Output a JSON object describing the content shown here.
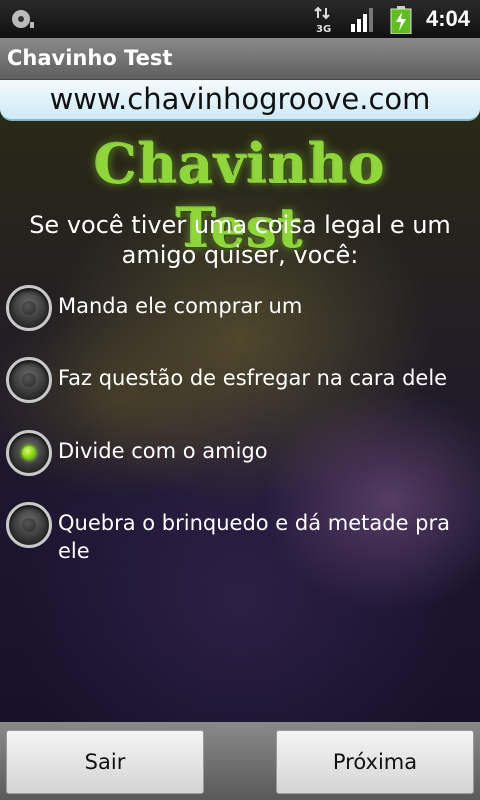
{
  "status_bar": {
    "time": "4:04",
    "icons": [
      "sd-card-icon",
      "network-3g-icon",
      "signal-icon",
      "battery-charging-icon"
    ]
  },
  "app_bar": {
    "title": "Chavinho Test"
  },
  "banner": {
    "url": "www.chavinhogroove.com"
  },
  "logo": {
    "text": "Chavinho Test",
    "color": "#8ed63a"
  },
  "question": {
    "text": "Se você tiver uma coisa legal e um amigo quiser, você:"
  },
  "options": [
    {
      "label": "Manda ele comprar um",
      "checked": false
    },
    {
      "label": "Faz questão de esfregar na cara dele",
      "checked": false
    },
    {
      "label": "Divide com o amigo",
      "checked": true
    },
    {
      "label": "Quebra o brinquedo e dá metade pra ele",
      "checked": false
    }
  ],
  "buttons": {
    "exit_label": "Sair",
    "next_label": "Próxima"
  }
}
